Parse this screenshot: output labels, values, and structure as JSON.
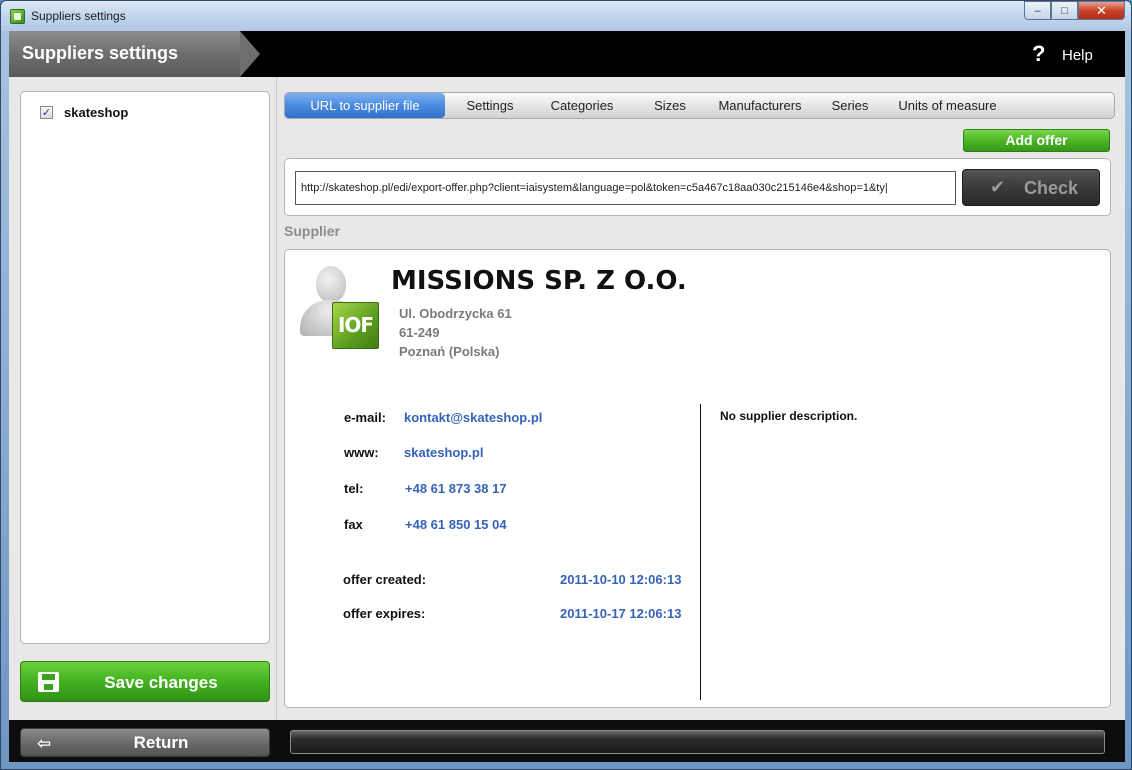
{
  "window": {
    "title": "Suppliers settings",
    "controls": {
      "minimize": "–",
      "maximize": "□",
      "close": "✕"
    }
  },
  "header": {
    "title": "Suppliers settings",
    "help_icon": "?",
    "help_label": "Help"
  },
  "sidebar": {
    "items": [
      {
        "label": "skateshop",
        "checked": true,
        "check_glyph": "✓"
      }
    ],
    "save_label": "Save changes"
  },
  "tabs": [
    {
      "label": "URL to supplier file",
      "active": true
    },
    {
      "label": "Settings",
      "active": false
    },
    {
      "label": "Categories",
      "active": false
    },
    {
      "label": "Sizes",
      "active": false
    },
    {
      "label": "Manufacturers",
      "active": false
    },
    {
      "label": "Series",
      "active": false
    },
    {
      "label": "Units of measure",
      "active": false
    }
  ],
  "actions": {
    "add_offer_label": "Add offer",
    "check_icon": "✔",
    "check_label": "Check"
  },
  "url_field": {
    "value": "http://skateshop.pl/edi/export-offer.php?client=iaisystem&language=pol&token=c5a467c18aa030c215146e4&shop=1&ty|"
  },
  "supplier": {
    "section_title": "Supplier",
    "logo_text": "IOF",
    "name": "MISSIONS SP. Z O.O.",
    "address_line1": "Ul. Obodrzycka 61",
    "address_line2": "61-249",
    "address_line3": "Poznań (Polska)",
    "email_label": "e-mail:",
    "email": "kontakt@skateshop.pl",
    "www_label": "www:",
    "www": "skateshop.pl",
    "tel_label": "tel:",
    "tel": "+48 61 873 38 17",
    "fax_label": "fax",
    "fax": "+48 61 850 15 04",
    "offer_created_label": "offer created:",
    "offer_created": "2011-10-10 12:06:13",
    "offer_expires_label": "offer expires:",
    "offer_expires": "2011-10-17 12:06:13",
    "description": "No supplier description."
  },
  "footer": {
    "return_icon": "⇦",
    "return_label": "Return",
    "progress_fraction": 0
  },
  "colors": {
    "accent_green": "#43b121",
    "link_blue": "#3563b8",
    "tab_active_blue": "#4c8be0"
  },
  "icons": [
    "app-icon",
    "help-icon",
    "save-disk-icon",
    "checkmark-icon",
    "return-arrow-icon",
    "supplier-avatar-icon"
  ]
}
